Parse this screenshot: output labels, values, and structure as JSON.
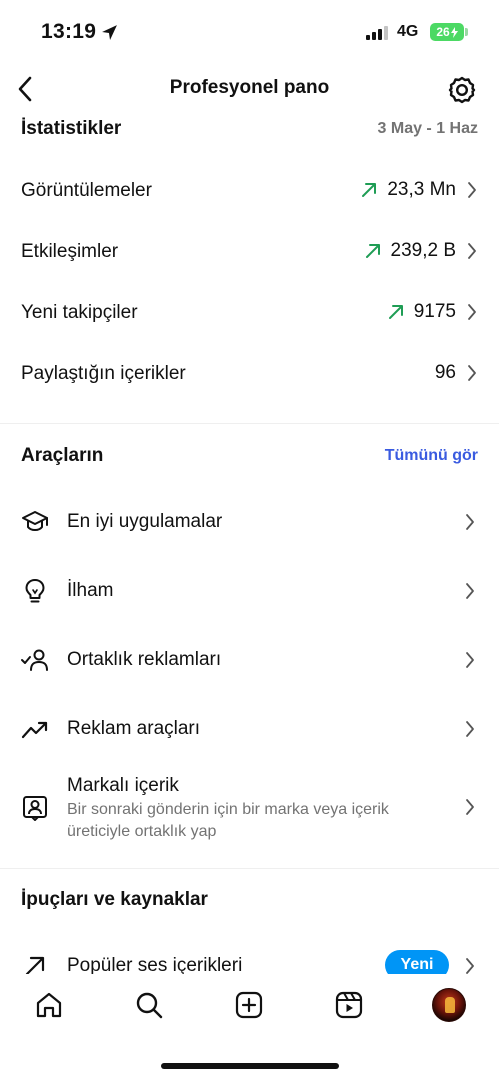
{
  "status_bar": {
    "time": "13:19",
    "network": "4G",
    "battery": "26"
  },
  "nav": {
    "title": "Profesyonel pano"
  },
  "insights": {
    "title": "İstatistikler",
    "date_range": "3 May - 1 Haz",
    "rows": [
      {
        "label": "Görüntülemeler",
        "value": "23,3 Mn",
        "trend": "up"
      },
      {
        "label": "Etkileşimler",
        "value": "239,2 B",
        "trend": "up"
      },
      {
        "label": "Yeni takipçiler",
        "value": "9175",
        "trend": "up"
      },
      {
        "label": "Paylaştığın içerikler",
        "value": "96",
        "trend": "none"
      }
    ]
  },
  "tools": {
    "title": "Araçların",
    "see_all": "Tümünü gör",
    "items": [
      {
        "label": "En iyi uygulamalar",
        "icon": "graduation-cap-icon"
      },
      {
        "label": "İlham",
        "icon": "lightbulb-icon"
      },
      {
        "label": "Ortaklık reklamları",
        "icon": "partner-check-icon"
      },
      {
        "label": "Reklam araçları",
        "icon": "trending-up-icon"
      },
      {
        "label": "Markalı içerik",
        "subtitle": "Bir sonraki gönderin için bir marka veya içerik üreticiyle ortaklık yap",
        "icon": "branded-content-icon"
      }
    ]
  },
  "tips": {
    "title": "İpuçları ve kaynaklar",
    "items": [
      {
        "label": "Popüler ses içerikleri",
        "badge": "Yeni",
        "icon": "arrow-up-right-icon"
      }
    ]
  },
  "colors": {
    "accent_link": "#3a5be0",
    "trend_up": "#1f9d55",
    "badge_blue": "#0095f6",
    "battery_green": "#4cd964"
  }
}
